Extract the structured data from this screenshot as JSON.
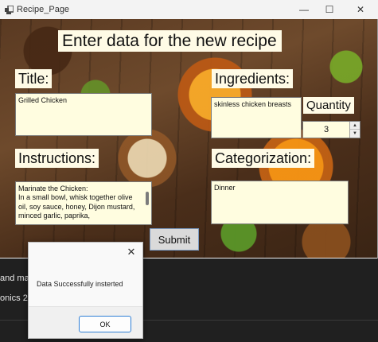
{
  "window": {
    "title": "Recipe_Page",
    "minimize": "—",
    "maximize": "☐",
    "close": "✕"
  },
  "form": {
    "header": "Enter data for the new recipe",
    "title_label": "Title:",
    "title_value": "Grilled Chicken",
    "ingredients_label": "Ingredients:",
    "ingredients_value": "skinless chicken breasts",
    "quantity_label": "Quantity",
    "quantity_value": "3",
    "instructions_label": "Instructions:",
    "instructions_value": "Marinate the Chicken:\nIn a small bowl, whisk together olive oil, soy sauce, honey, Dijon mustard, minced garlic, paprika,",
    "categorization_label": "Categorization:",
    "categorization_value": "Dinner",
    "submit_label": "Submit"
  },
  "background_app": {
    "line1": "and ma",
    "line2": "onics 2"
  },
  "message_box": {
    "text": "Data Successfully insterted",
    "ok_label": "OK",
    "close": "✕"
  }
}
